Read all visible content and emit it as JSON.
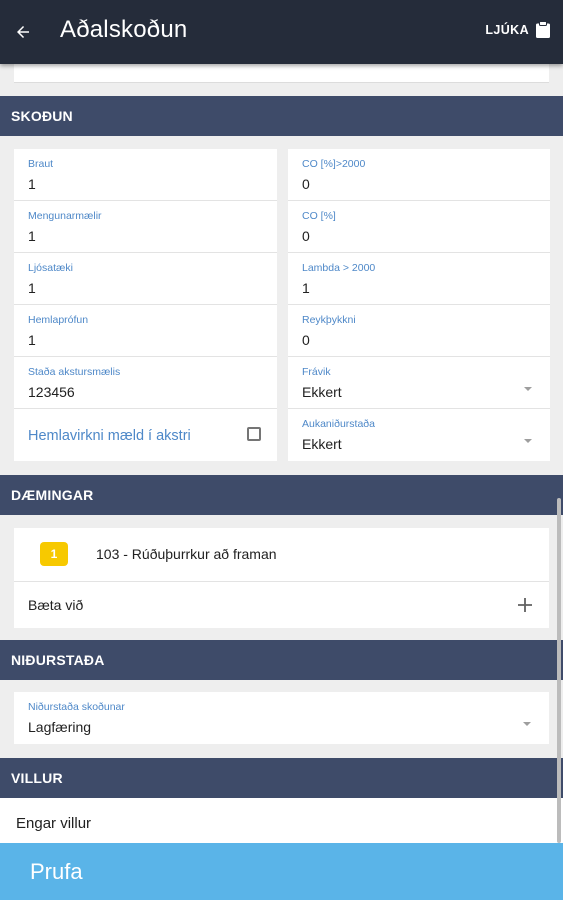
{
  "appbar": {
    "title": "Aðalskoðun",
    "finish_label": "LJÚKA",
    "back_icon": "arrow-left-icon",
    "finish_icon": "clipboard-icon"
  },
  "sections": {
    "inspection": "SKOÐUN",
    "defects": "DÆMINGAR",
    "result": "NIÐURSTAÐA",
    "errors": "VILLUR"
  },
  "inspection": {
    "left": [
      {
        "label": "Braut",
        "value": "1"
      },
      {
        "label": "Mengunarmælir",
        "value": "1"
      },
      {
        "label": "Ljósatæki",
        "value": "1"
      },
      {
        "label": "Hemlaprófun",
        "value": "1"
      },
      {
        "label": "Staða akstursmælis",
        "value": "123456"
      }
    ],
    "checkbox_label": "Hemlavirkni mæld í akstri",
    "checkbox_checked": false,
    "right": [
      {
        "label": "CO [%]>2000",
        "value": "0"
      },
      {
        "label": "CO [%]",
        "value": "0"
      },
      {
        "label": "Lambda > 2000",
        "value": "1"
      },
      {
        "label": "Reykþykkni",
        "value": "0"
      }
    ],
    "deviation": {
      "label": "Frávik",
      "value": "Ekkert"
    },
    "extra_result": {
      "label": "Aukaniðurstaða",
      "value": "Ekkert"
    }
  },
  "defects": {
    "items": [
      {
        "badge": "1",
        "text": "103 - Rúðuþurrkur að framan"
      }
    ],
    "add_label": "Bæta við",
    "add_icon": "plus-icon"
  },
  "result": {
    "label": "Niðurstaða skoðunar",
    "value": "Lagfæring"
  },
  "errors": {
    "text": "Engar villur"
  },
  "bottom_bar": {
    "label": "Prufa"
  },
  "colors": {
    "appbar": "#252c3a",
    "section_header": "#3e4b69",
    "label_blue": "#4e88c8",
    "badge_yellow": "#f7c900",
    "bottom_bar": "#5ab4e8"
  }
}
